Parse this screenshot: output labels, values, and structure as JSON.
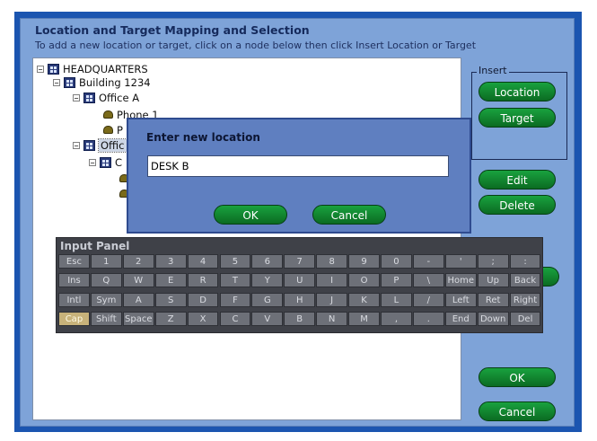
{
  "header": {
    "title": "Location and Target Mapping and Selection",
    "subtitle": "To add a new location or target, click on a node below then click Insert Location or Target"
  },
  "tree": {
    "hq": "HEADQUARTERS",
    "building": "Building 1234",
    "office_a": "Office A",
    "phone1": "Phone 1",
    "phone2": "P",
    "office_b": "Offic",
    "child": "C"
  },
  "insert_group": {
    "label": "Insert",
    "location": "Location",
    "target": "Target"
  },
  "actions": {
    "edit": "Edit",
    "delete": "Delete",
    "ok": "OK",
    "cancel": "Cancel"
  },
  "dialog": {
    "title": "Enter new location",
    "value": "DESK B",
    "ok": "OK",
    "cancel": "Cancel"
  },
  "keyboard": {
    "title": "Input Panel",
    "rows": [
      [
        "Esc",
        "1",
        "2",
        "3",
        "4",
        "5",
        "6",
        "7",
        "8",
        "9",
        "0",
        "-",
        "'",
        ";",
        ":"
      ],
      [
        "Ins",
        "Q",
        "W",
        "E",
        "R",
        "T",
        "Y",
        "U",
        "I",
        "O",
        "P",
        "\\",
        "Home",
        "Up",
        "Back"
      ],
      [
        "Intl",
        "Sym",
        "A",
        "S",
        "D",
        "F",
        "G",
        "H",
        "J",
        "K",
        "L",
        "/",
        "Left",
        "Ret",
        "Right"
      ],
      [
        "Cap",
        "Shift",
        "Space",
        "Z",
        "X",
        "C",
        "V",
        "B",
        "N",
        "M",
        ",",
        ".",
        "End",
        "Down",
        "Del"
      ]
    ]
  }
}
